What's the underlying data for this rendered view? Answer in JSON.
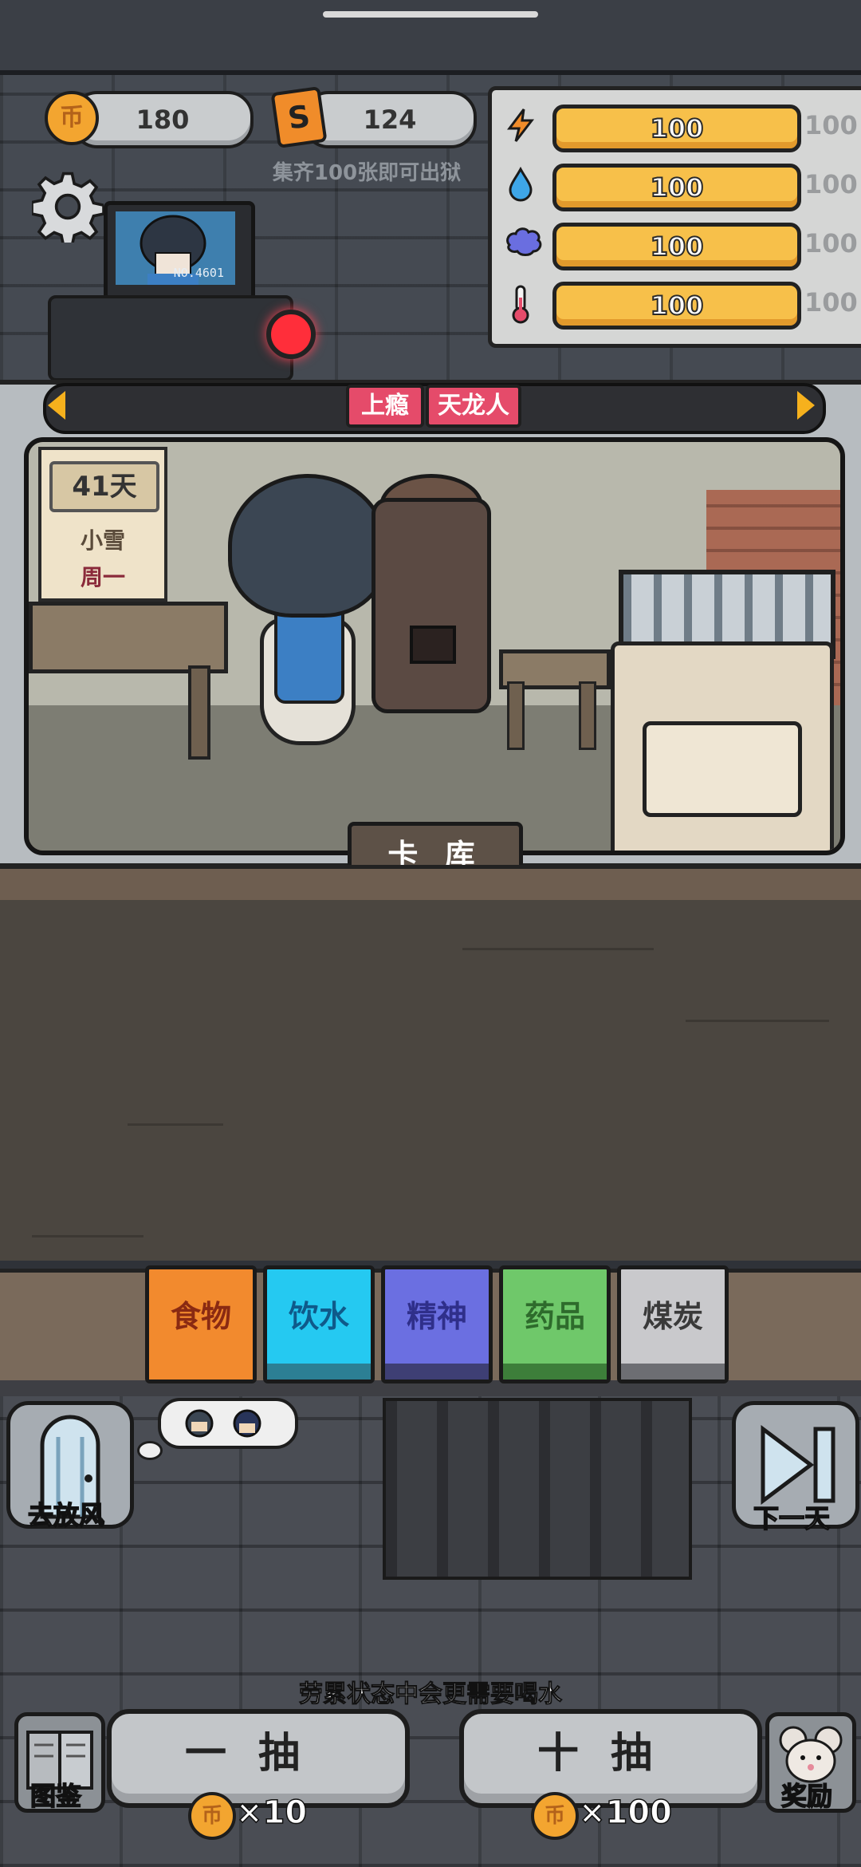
{
  "resources": {
    "coins": "180",
    "coin_icon": "币",
    "cards": "124",
    "card_icon": "S",
    "hint": "集齐100张即可出狱"
  },
  "monitor": {
    "id": "NO.4601"
  },
  "stats": [
    {
      "icon": "energy-icon",
      "glyph": "⚡",
      "value": "100",
      "max": "100",
      "color": "#f08c2a"
    },
    {
      "icon": "water-icon",
      "glyph": "💧",
      "value": "100",
      "max": "100",
      "color": "#3ea6e8"
    },
    {
      "icon": "brain-icon",
      "glyph": "🧠",
      "value": "100",
      "max": "100",
      "color": "#6a6ee0"
    },
    {
      "icon": "thermometer-icon",
      "glyph": "🌡",
      "value": "100",
      "max": "100",
      "color": "#e54b6a"
    }
  ],
  "banner": {
    "tags": [
      "上瘾",
      "天龙人"
    ]
  },
  "calendar": {
    "days": "41天",
    "weather": "小雪",
    "weekday": "周一"
  },
  "card_library": {
    "label": "卡 库"
  },
  "categories": [
    {
      "label": "食物",
      "color": "#f28a2e",
      "text": "#8a2a12",
      "bottom": "#f28a2e"
    },
    {
      "label": "饮水",
      "color": "#25c9f1",
      "text": "#0f5a8a",
      "bottom": "#2c7f94"
    },
    {
      "label": "精神",
      "color": "#6b6fe1",
      "text": "#2f2f8a",
      "bottom": "#3e3f74"
    },
    {
      "label": "药品",
      "color": "#6fc86a",
      "text": "#2e6b2c",
      "bottom": "#3d7e3a"
    },
    {
      "label": "煤炭",
      "color": "#c9c9cc",
      "text": "#3a3a3a",
      "bottom": "#6d6e73"
    }
  ],
  "actions": {
    "go_out": "去放风",
    "next_day": "下一天",
    "tip": "劳累状态中会更需要喝水",
    "catalog": "图鉴",
    "reward": "奖励",
    "draw_one": "一抽",
    "draw_one_cost": "×10",
    "draw_ten": "十抽",
    "draw_ten_cost": "×100"
  }
}
